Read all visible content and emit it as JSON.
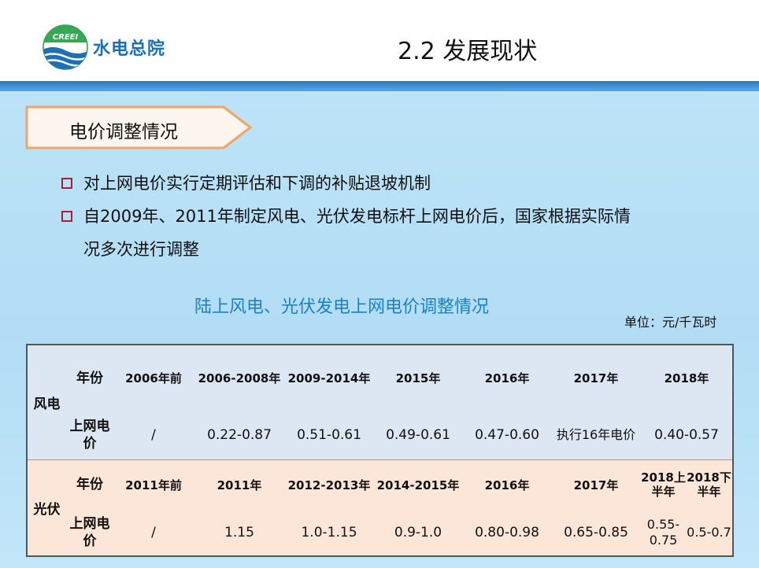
{
  "header": {
    "logo_badge": "CREEI",
    "logo_text": "水电总院",
    "slide_title": "2.2 发展现状"
  },
  "section_tag": "电价调整情况",
  "bullets": [
    "对上网电价实行定期评估和下调的补贴退坡机制",
    "自2009年、2011年制定风电、光伏发电标杆上网电价后，国家根据实际情",
    "况多次进行调整"
  ],
  "table": {
    "title": "陆上风电、光伏发电上网电价调整情况",
    "unit": "单位：元/千瓦时",
    "wind": {
      "label": "风电",
      "year_label": "年份",
      "price_label": "上网电价",
      "years": [
        "2006年前",
        "2006-2008年",
        "2009-2014年",
        "2015年",
        "2016年",
        "2017年",
        "2018年"
      ],
      "prices": [
        "/",
        "0.22-0.87",
        "0.51-0.61",
        "0.49-0.61",
        "0.47-0.60",
        "执行16年电价",
        "0.40-0.57"
      ]
    },
    "solar": {
      "label": "光伏",
      "year_label": "年份",
      "price_label": "上网电价",
      "years": [
        "2011年前",
        "2011年",
        "2012-2013年",
        "2014-2015年",
        "2016年",
        "2017年"
      ],
      "year_2018_h1": "2018上半年",
      "year_2018_h2": "2018下半年",
      "prices": [
        "/",
        "1.15",
        "1.0-1.15",
        "0.9-1.0",
        "0.80-0.98",
        "0.65-0.85"
      ],
      "price_2018_h1": "0.55-0.75",
      "price_2018_h2": "0.5-0.7"
    }
  },
  "colors": {
    "title_blue": "#1a82c4",
    "stripe_blue": "#2b78c2",
    "bullet_square": "#a3223a",
    "tag_border": "#f2a466",
    "wind_bg": "#dde7f3",
    "solar_bg": "#fbe6d8"
  },
  "icons": {
    "logo": "creei-wave-logo",
    "tag": "arrow-tag-shape",
    "bullet": "hollow-square"
  }
}
